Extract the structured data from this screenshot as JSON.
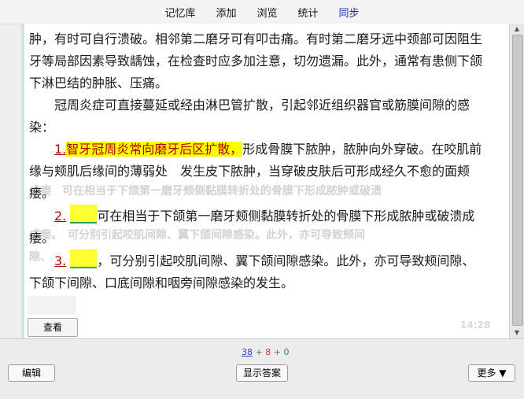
{
  "nav": {
    "items": [
      "记忆库",
      "添加",
      "浏览",
      "统计",
      "同步"
    ]
  },
  "card": {
    "para1": "肿，有时可自行溃破。相邻第二磨牙可有叩击痛。有时第二磨牙远中颈部可因阻生牙等局部因素导致龋蚀，在检查时应多加注意，切勿遗漏。此外，通常有患侧下颌下淋巴结的肿胀、压痛。",
    "para2": "冠周炎症可直接蔓延或经由淋巴管扩散，引起邻近组织器官或筋膜间隙的感染：",
    "item1": {
      "num": "1.",
      "highlight_a": "智牙",
      "highlight_b": "冠周炎常向磨牙后区扩散，",
      "rest": "形成骨膜下脓肿，脓肿向外穿破。在咬肌前缘与颊肌后缘间的薄弱处　发生皮下脓肿，当穿破皮肤后可形成经久不愈的面颊瘘。"
    },
    "item2": {
      "num": "2.",
      "rest": "可在相当于下颌第一磨牙颊侧黏膜转折处的骨膜下形成脓肿或破溃成瘘。"
    },
    "item3": {
      "num": "3.",
      "rest": "，可分别引起咬肌间隙、翼下颌间隙感染。此外，亦可导致颊间隙、　下颌下间隙、口底间隙和咽旁间隙感染的发生。"
    },
    "ghost_line1": "成瘘　可在相当于下颌第一磨牙颊侧黏膜转折处的骨膜下形成脓肿或破溃",
    "ghost_line2": "成瘘。　可分别引起咬肌间隙、翼下颌间隙感染。此外，亦可导致颊间",
    "ghost_line3": "隙、"
  },
  "view_button": "查看",
  "timer": "14:28",
  "counts": {
    "blue": "38",
    "red": "8",
    "green": "0",
    "sep1": "+",
    "sep2": "+"
  },
  "buttons": {
    "edit": "编辑",
    "show_answer": "显示答案",
    "more": "更多 ▼"
  },
  "colors": {
    "highlight": "#ffff00",
    "number_red": "#b10000",
    "nav_active": "#1d2fa8"
  }
}
